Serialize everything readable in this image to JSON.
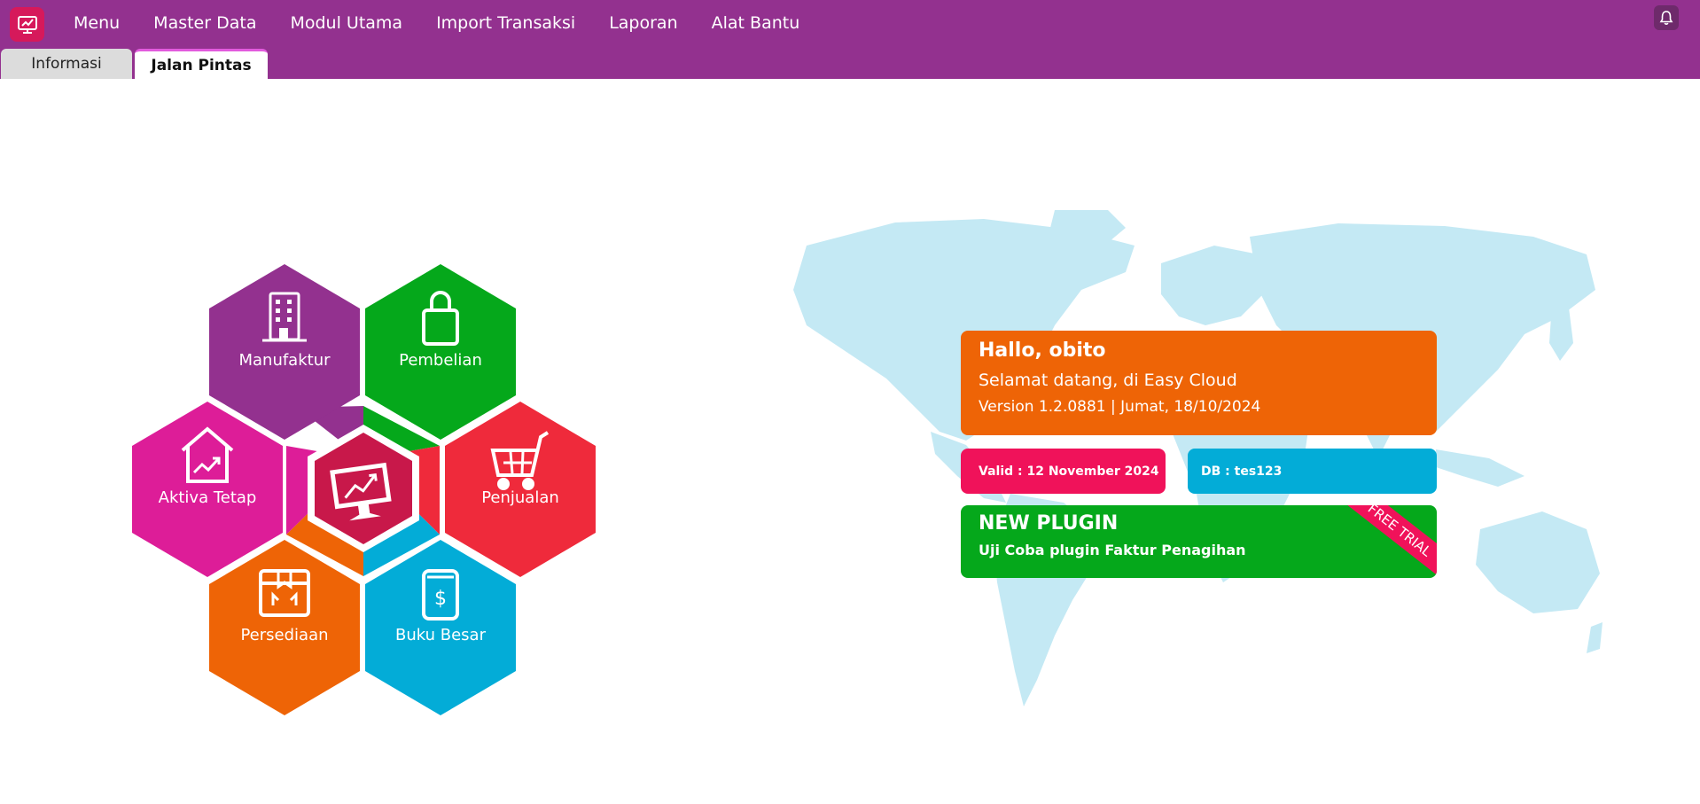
{
  "menubar": {
    "items": [
      "Menu",
      "Master Data",
      "Modul Utama",
      "Import Transaksi",
      "Laporan",
      "Alat Bantu"
    ]
  },
  "tabs": {
    "informasi": "Informasi",
    "jalan_pintas": "Jalan Pintas"
  },
  "shortcuts": {
    "manufaktur": "Manufaktur",
    "pembelian": "Pembelian",
    "aktiva_tetap": "Aktiva Tetap",
    "penjualan": "Penjualan",
    "persediaan": "Persediaan",
    "buku_besar": "Buku Besar"
  },
  "welcome": {
    "greeting": "Hallo, obito",
    "subtitle": "Selamat datang, di Easy Cloud",
    "version": "Version 1.2.0881 | Jumat, 18/10/2024"
  },
  "license": {
    "valid": "Valid : 12 November 2024",
    "db": "DB : tes123"
  },
  "plugin": {
    "title": "NEW PLUGIN",
    "desc": "Uji Coba plugin Faktur Penagihan",
    "ribbon": "FREE TRIAL"
  },
  "colors": {
    "topbar": "#93318f",
    "manufaktur": "#93318f",
    "pembelian": "#05a81b",
    "aktiva_tetap": "#dd1d98",
    "penjualan": "#ef2a3b",
    "persediaan": "#ee6406",
    "buku_besar": "#03acd7",
    "center": "#c8184a",
    "map": "#c4e9f4"
  },
  "icons": {
    "app_logo": "monitor-chart-icon",
    "bell": "bell-icon",
    "manufaktur": "building-icon",
    "pembelian": "shopping-bag-icon",
    "aktiva_tetap": "house-chart-icon",
    "penjualan": "shopping-cart-icon",
    "persediaan": "package-icon",
    "buku_besar": "ledger-dollar-icon",
    "center": "monitor-chart-icon"
  }
}
